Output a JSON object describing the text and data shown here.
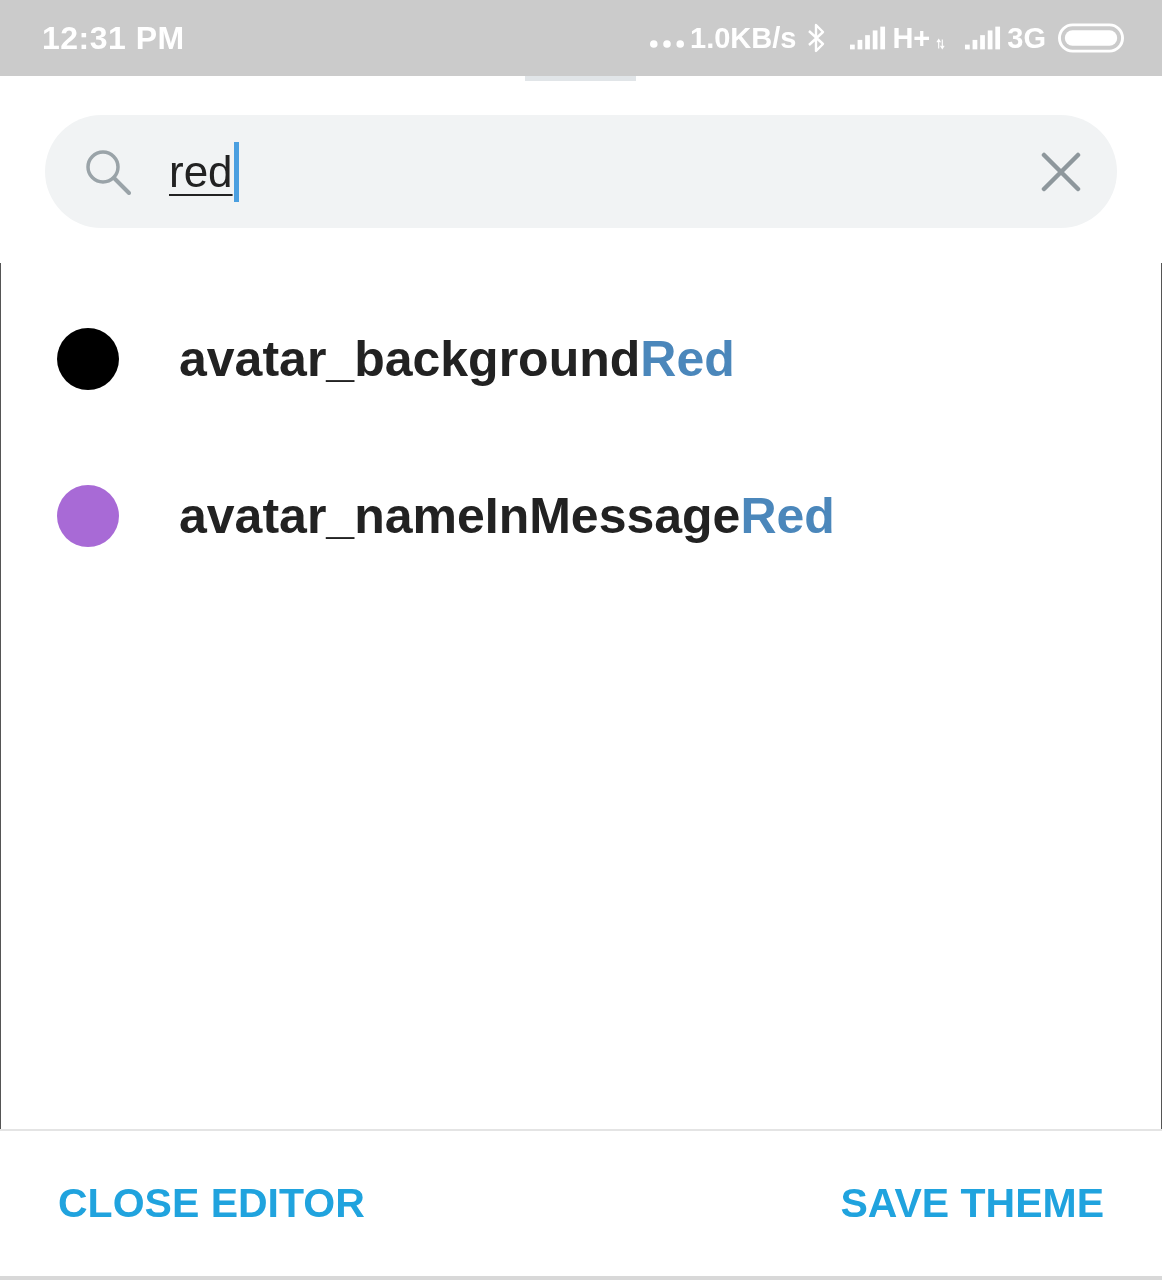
{
  "status_bar": {
    "time": "12:31 PM",
    "speed": "1.0KB/s",
    "network_1": "H+",
    "network_2": "3G"
  },
  "search": {
    "value": "red"
  },
  "results": [
    {
      "name": "avatar_background",
      "match": "Red",
      "color": "#000000"
    },
    {
      "name": "avatar_nameInMessage",
      "match": "Red",
      "color": "#a86ad6"
    }
  ],
  "buttons": [
    {
      "label": "CLOSE EDITOR"
    },
    {
      "label": "SAVE THEME"
    }
  ]
}
